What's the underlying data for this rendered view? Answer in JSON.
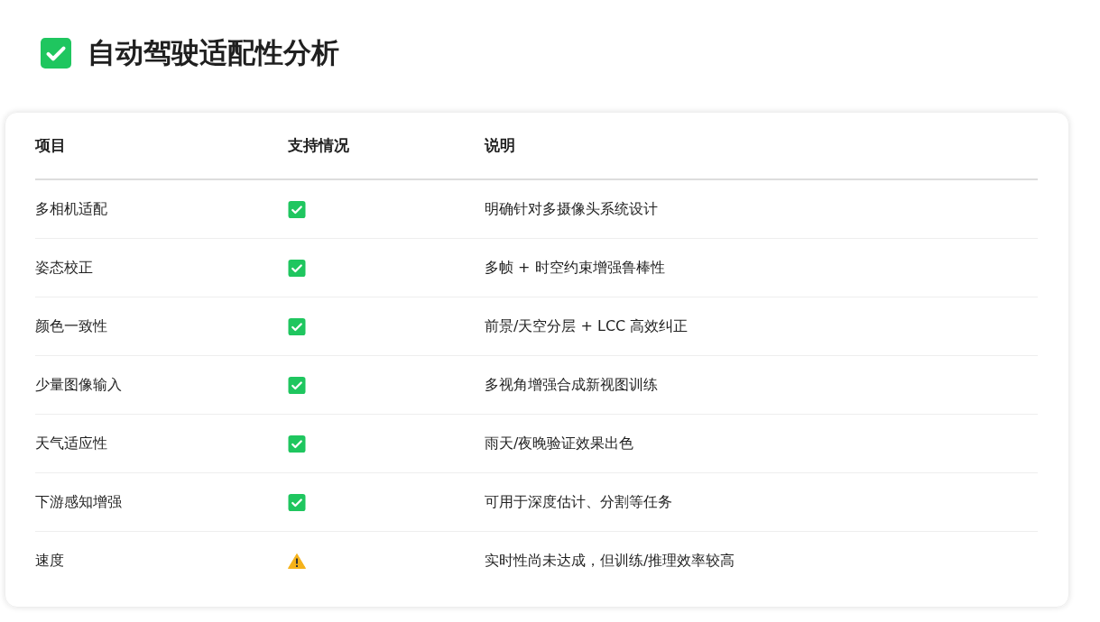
{
  "title": "自动驾驶适配性分析",
  "table": {
    "columns": [
      "项目",
      "支持情况",
      "说明"
    ],
    "rows": [
      {
        "item": "多相机适配",
        "kind": "check",
        "note": "明确针对多摄像头系统设计"
      },
      {
        "item": "姿态校正",
        "kind": "check",
        "note": "多帧 + 时空约束增强鲁棒性"
      },
      {
        "item": "颜色一致性",
        "kind": "check",
        "note": "前景/天空分层 + LCC 高效纠正"
      },
      {
        "item": "少量图像输入",
        "kind": "check",
        "note": "多视角增强合成新视图训练"
      },
      {
        "item": "天气适应性",
        "kind": "check",
        "note": "雨天/夜晚验证效果出色"
      },
      {
        "item": "下游感知增强",
        "kind": "check",
        "note": "可用于深度估计、分割等任务"
      },
      {
        "item": "速度",
        "kind": "warning",
        "note": "实时性尚未达成，但训练/推理效率较高"
      }
    ]
  }
}
